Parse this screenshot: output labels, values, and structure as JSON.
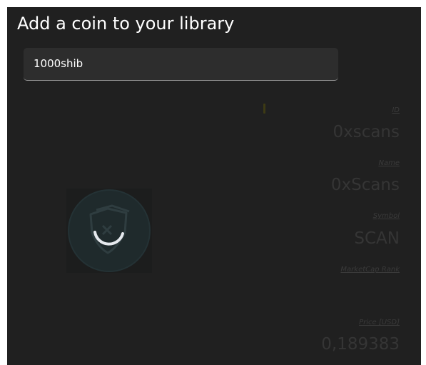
{
  "dialog": {
    "title": "Add a coin to your library"
  },
  "search": {
    "value": "1000shib",
    "placeholder": ""
  },
  "details": {
    "id_label": "ID",
    "id_value": "0xscans",
    "name_label": "Name",
    "name_value": "0xScans",
    "symbol_label": "Symbol",
    "symbol_value": "SCAN",
    "rank_label": "MarketCap Rank",
    "rank_value": "",
    "price_label": "Price [USD]",
    "price_value": "0,189383"
  },
  "icons": {
    "logo": "coin-logo-icon",
    "spinner": "loading-spinner-icon"
  },
  "colors": {
    "background": "#202020",
    "input_background": "#2d2d2d",
    "title_text": "#ffffff",
    "dimmed_text": "#353535",
    "spinner": "#e6e9ee"
  }
}
